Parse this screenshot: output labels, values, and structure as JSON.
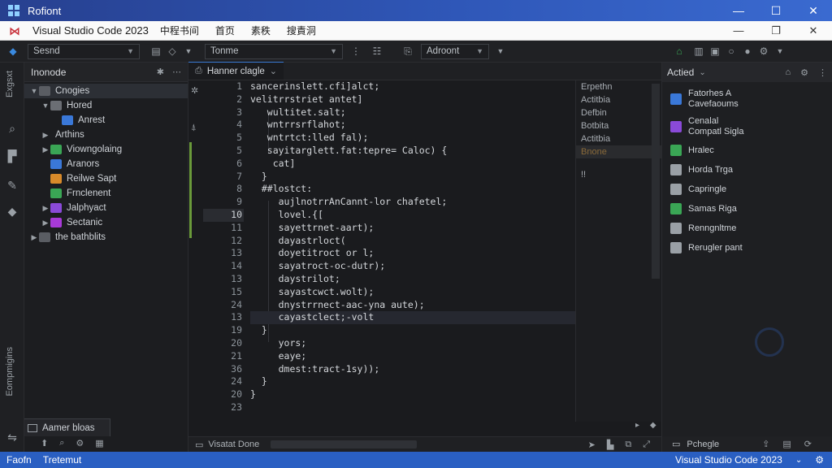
{
  "os": {
    "title": "Rofiont",
    "controls": [
      "—",
      "☐",
      "✕"
    ]
  },
  "menu": {
    "app_title": "Visual Studio Code 2023",
    "items": [
      "中程书间",
      "首页",
      "素秩",
      "搜責洞"
    ],
    "controls": [
      "—",
      "❐",
      "✕"
    ]
  },
  "toolbar": {
    "select1": "Sesnd",
    "select2": "Tonme",
    "select3": "Adroont"
  },
  "activity": {
    "top_text": "Exgsxt",
    "bottom_text": "Eompmigins"
  },
  "explorer": {
    "title": "Inonode",
    "tree": [
      {
        "label": "Cnogies",
        "indent": 0,
        "twisty": "▼",
        "icon": "#5a5d63"
      },
      {
        "label": "Hored",
        "indent": 1,
        "twisty": "▼",
        "icon": "#6b6e74"
      },
      {
        "label": "Anrest",
        "indent": 2,
        "twisty": "",
        "icon": "#3a78d8"
      },
      {
        "label": "Arthins",
        "indent": 1,
        "twisty": "▶",
        "icon": ""
      },
      {
        "label": "Viowngolaing",
        "indent": 1,
        "twisty": "▶",
        "icon": "#3aa655"
      },
      {
        "label": "Aranors",
        "indent": 1,
        "twisty": "",
        "icon": "#3a78d8"
      },
      {
        "label": "Reilwe Sapt",
        "indent": 1,
        "twisty": "",
        "icon": "#d88a2a"
      },
      {
        "label": "Frnclenent",
        "indent": 1,
        "twisty": "",
        "icon": "#3aa655"
      },
      {
        "label": "Jalphyact",
        "indent": 1,
        "twisty": "▶",
        "icon": "#8a4ad8"
      },
      {
        "label": "Sectanic",
        "indent": 1,
        "twisty": "▶",
        "icon": "#a83ad8"
      },
      {
        "label": "the bathblits",
        "indent": 0,
        "twisty": "▶",
        "icon": "#5a5d63"
      }
    ],
    "bottom_tab": "Aamer bloas"
  },
  "editor": {
    "tab_label": "Hanner clagle",
    "line_numbers": [
      "1",
      "2",
      "3",
      "4",
      "5",
      "5",
      "6",
      "7",
      "8",
      "9",
      "10",
      "11",
      "12",
      "13",
      "14",
      "13",
      "15",
      "24",
      "13",
      "19",
      "20",
      "21",
      "36",
      "24",
      "20",
      "23"
    ],
    "highlight_index": 10,
    "code": [
      "sancerinslett.cfi]alct;",
      "velitrrstriet antet]",
      "   wultitet.salt;",
      "   wntrrsrflahot;",
      "   wntrtct:lled fal);",
      "   sayitarglett.fat:tepre= Caloc) {",
      "    cat]",
      "  }",
      "  ##lostct:",
      "     aujlnotrrAnCannt-lor chafetel;",
      "     lovel.{[",
      "     sayettrnet-aart);",
      "     dayastrloct(",
      "     doyetitroct or l;",
      "     sayatroct-oc-dutr);",
      "     daystrilot;",
      "     sayastcwct.wolt);",
      "     dnystrrnect-aac-yna aute);",
      "     cayastclect;-volt",
      "  }",
      "     yors;",
      "     eaye;",
      "     dmest:tract-1sy));",
      "  }",
      "}"
    ],
    "minimap": [
      "Erpethn",
      "Actitbia",
      "Defbin",
      "Botbita",
      "Actitbia",
      "Bnone",
      "!!"
    ],
    "status_label": "Visatat Done"
  },
  "right_panel": {
    "title": "Actied",
    "items": [
      {
        "line1": "Fatorhes A",
        "line2": "Cavefaoums",
        "icon": "#3a78d8",
        "two": true
      },
      {
        "line1": "Cenalal",
        "line2": "Compatl Sigla",
        "icon": "#8a4ad8",
        "two": true
      },
      {
        "line1": "Hralec",
        "line2": "",
        "icon": "#3aa655",
        "two": false
      },
      {
        "line1": "Horda Trga",
        "line2": "",
        "icon": "#9aa0a6",
        "two": false
      },
      {
        "line1": "Capringle",
        "line2": "",
        "icon": "#9aa0a6",
        "two": false
      },
      {
        "line1": "Samas Riga",
        "line2": "",
        "icon": "#3aa655",
        "two": false
      },
      {
        "line1": "Renngnltme",
        "line2": "",
        "icon": "#9aa0a6",
        "two": false
      },
      {
        "line1": "Rerugler pant",
        "line2": "",
        "icon": "#9aa0a6",
        "two": false
      }
    ],
    "footer": "Pchegle"
  },
  "status": {
    "left": "Faofn",
    "mid": "Tretemut",
    "right": "Visual Studio Code 2023"
  }
}
